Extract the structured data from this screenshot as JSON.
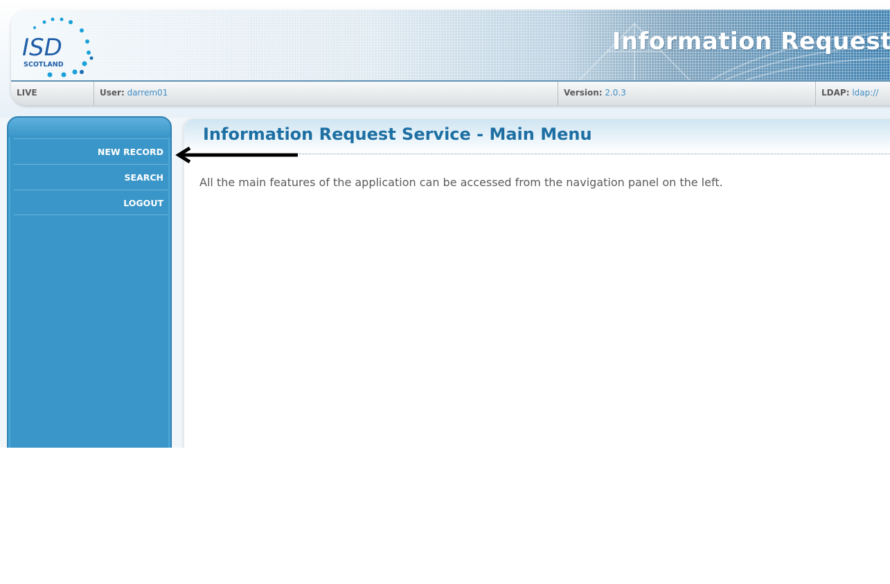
{
  "header": {
    "logo_text": "ISD",
    "logo_subtext": "SCOTLAND",
    "app_title": "Information Request"
  },
  "statusbar": {
    "environment": "LIVE",
    "user_label": "User:",
    "user_value": "darrem01",
    "version_label": "Version:",
    "version_value": "2.0.3",
    "ldap_label": "LDAP:",
    "ldap_value": "ldap://"
  },
  "sidebar": {
    "items": [
      {
        "label": "NEW RECORD"
      },
      {
        "label": "SEARCH"
      },
      {
        "label": "LOGOUT"
      }
    ]
  },
  "main": {
    "title": "Information Request Service - Main Menu",
    "intro": "All the main features of the application can be accessed from the navigation panel on the left."
  },
  "annotation": {
    "arrow_target": "NEW RECORD",
    "arrow_color": "#000000"
  },
  "colors": {
    "sidebar": "#3a96c8",
    "title": "#1d6fa3",
    "link_value": "#3f8dc4"
  }
}
